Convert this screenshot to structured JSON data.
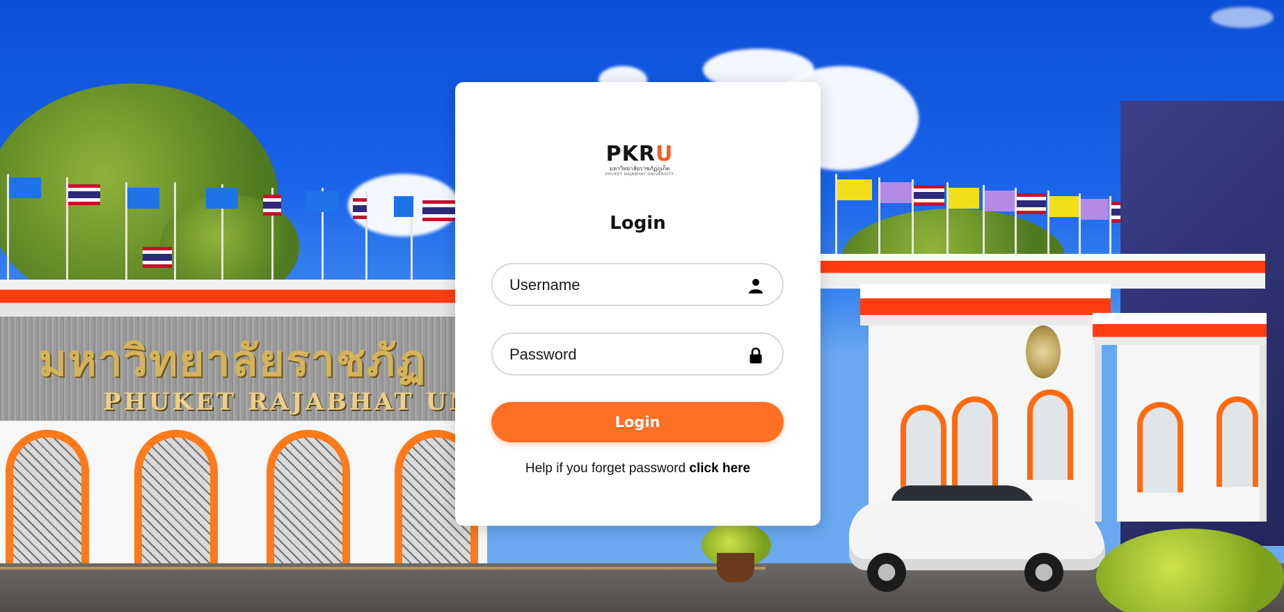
{
  "brand": {
    "logo_mark_main": "PKR",
    "logo_mark_accent": "U",
    "logo_thai": "มหาวิทยาลัยราชภัฏภูเก็ต",
    "logo_en": "PHUKET RAJABHAT UNIVERSITY",
    "accent_color": "#ff6f24"
  },
  "login": {
    "title": "Login",
    "username_placeholder": "Username",
    "username_icon": "user-icon",
    "password_placeholder": "Password",
    "password_icon": "lock-icon",
    "submit_label": "Login",
    "help_text": "Help if you forget password ",
    "help_link": "click here"
  },
  "background": {
    "sign_thai": "มหาวิทยาลัยราชภัฏ",
    "sign_en": "PHUKET RAJABHAT UNIVER"
  }
}
